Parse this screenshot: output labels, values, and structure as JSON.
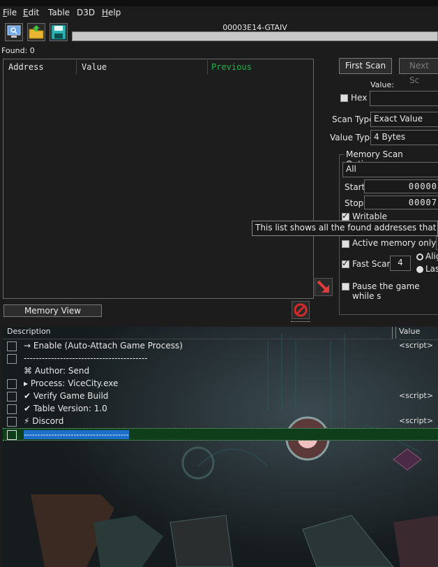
{
  "menu": [
    {
      "label": "File",
      "u": "F",
      "rest": "ile"
    },
    {
      "label": "Edit",
      "u": "E",
      "rest": "dit"
    },
    {
      "label": "Table",
      "u": "",
      "rest": "Table"
    },
    {
      "label": "D3D",
      "u": "",
      "rest": "D3D"
    },
    {
      "label": "Help",
      "u": "H",
      "rest": "elp"
    }
  ],
  "toolbar": {
    "process_icon": "monitor-icon",
    "open_icon": "folder-open-icon",
    "save_icon": "save-icon"
  },
  "process_title": "00003E14-GTAIV",
  "found_label": "Found: 0",
  "results": {
    "columns": [
      "Address",
      "Value",
      "Previous"
    ],
    "previous_color": "#22b14c"
  },
  "scan": {
    "first_scan": "First Scan",
    "next_scan": "Next Sc",
    "value_label": "Value:",
    "hex_label": "Hex",
    "scan_type_label": "Scan Type",
    "scan_type_value": "Exact Value",
    "value_type_label": "Value Type",
    "value_type_value": "4 Bytes",
    "memory_options_label": "Memory Scan Options",
    "region_value": "All",
    "start_label": "Start",
    "start_value": "00000",
    "stop_label": "Stop",
    "stop_value": "00007",
    "writable_label": "Writable",
    "active_memory_label": "Active memory only",
    "fast_scan_label": "Fast Scan",
    "fast_scan_value": "4",
    "align_label": "Alig",
    "last_label": "Las",
    "pause_label": "Pause the game while s"
  },
  "tooltip": "This list shows all the found addresses that matche",
  "memory_view": "Memory View",
  "table": {
    "headers": {
      "description": "Description",
      "value": "Value"
    },
    "rows": [
      {
        "desc": "→ Enable (Auto-Attach Game Process)",
        "value": "<script>"
      },
      {
        "desc": "-----------------------------------------",
        "value": ""
      },
      {
        "desc": "⌘ Author:  Send",
        "value": ""
      },
      {
        "desc": "▸ Process: ViceCity.exe",
        "value": ""
      },
      {
        "desc": "✔ Verify Game Build",
        "value": "<script>"
      },
      {
        "desc": "✔ Table Version: 1.0",
        "value": ""
      },
      {
        "desc": "⚡ Discord",
        "value": "<script>"
      },
      {
        "desc": "--------------------------------------",
        "value": ""
      }
    ]
  },
  "colors": {
    "selected_row": "#0f3e1b",
    "selected_text_bg": "#1b6fc9",
    "arrow_red": "#e23b3b",
    "no_sign_red": "#d42a2a"
  }
}
